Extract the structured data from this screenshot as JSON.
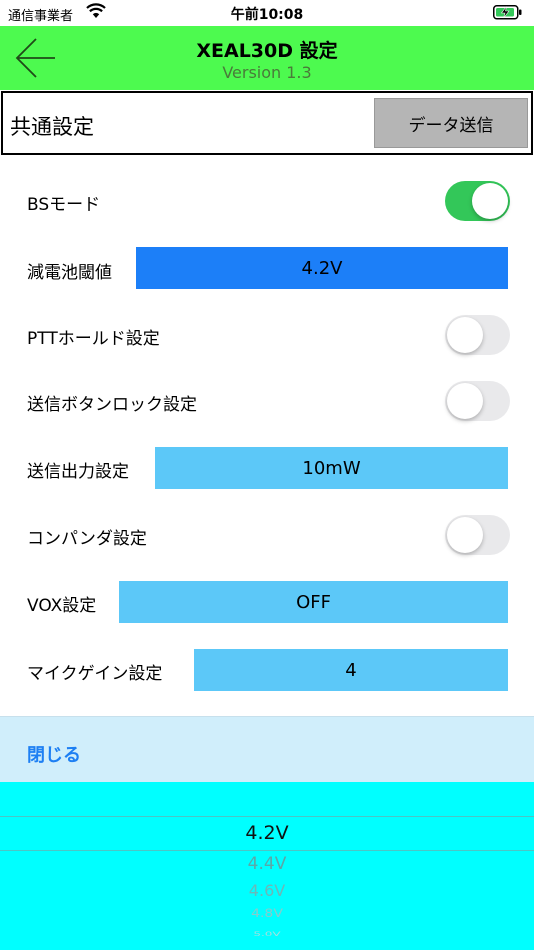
{
  "status_bar": {
    "carrier": "通信事業者",
    "time": "午前10:08"
  },
  "nav": {
    "title": "XEAL30D 設定",
    "version": "Version 1.3"
  },
  "section": {
    "title": "共通設定",
    "send_label": "データ送信"
  },
  "settings": {
    "bs_mode": {
      "label": "BSモード",
      "on": true
    },
    "battery_threshold": {
      "label": "減電池閾値",
      "value": "4.2V"
    },
    "ptt_hold": {
      "label": "PTTホールド設定",
      "on": false
    },
    "tx_button_lock": {
      "label": "送信ボタンロック設定",
      "on": false
    },
    "tx_power": {
      "label": "送信出力設定",
      "value": "10mW"
    },
    "compander": {
      "label": "コンパンダ設定",
      "on": false
    },
    "vox": {
      "label": "VOX設定",
      "value": "OFF"
    },
    "mic_gain": {
      "label": "マイクゲイン設定",
      "value": "4"
    }
  },
  "picker": {
    "close_label": "閉じる",
    "options": [
      "4.2V",
      "4.4V",
      "4.6V",
      "4.8V",
      "5.0V"
    ],
    "selected": "4.2V"
  },
  "colors": {
    "nav_bg": "#4dfa4f",
    "toggle_on": "#33c759",
    "field_active": "#1c7ff8",
    "field": "#5cc8f8",
    "picker_bg": "#00ffff"
  }
}
